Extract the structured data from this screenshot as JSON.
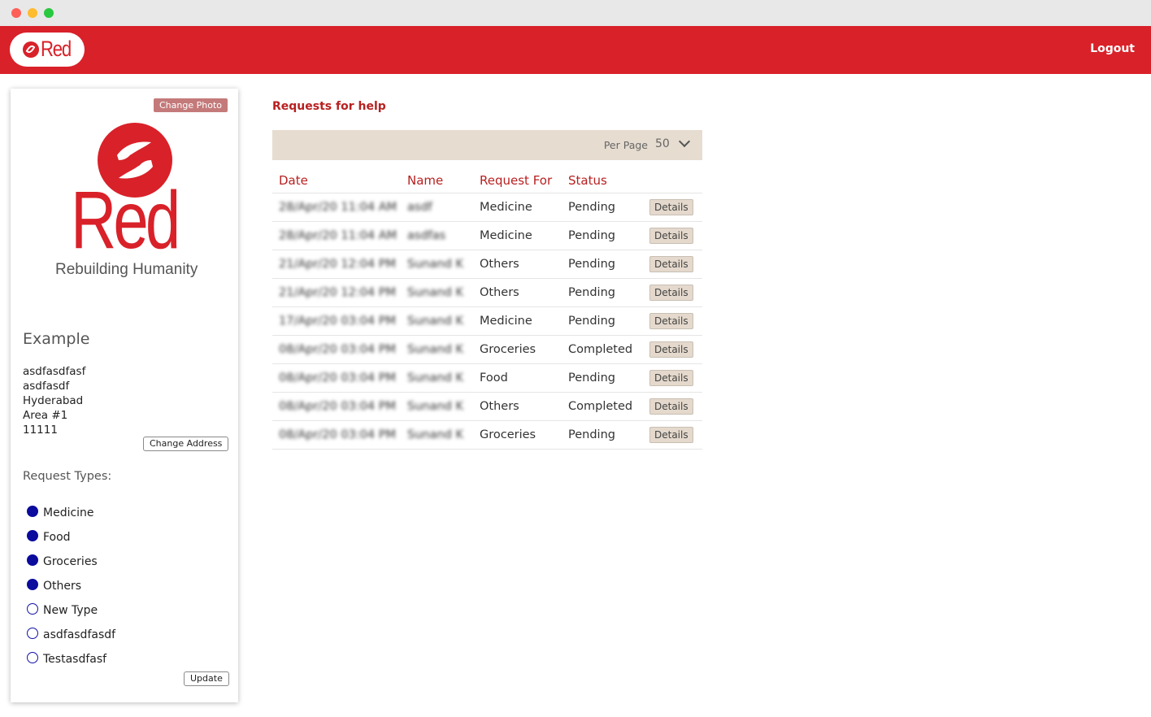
{
  "header": {
    "logo_text": "Red",
    "logout_label": "Logout"
  },
  "profile": {
    "change_photo_label": "Change Photo",
    "brand_name": "Red",
    "brand_tagline": "Rebuilding Humanity",
    "name": "Example",
    "address_lines": [
      "asdfasdfasf",
      "asdfasdf",
      "Hyderabad",
      "Area #1",
      "11111"
    ],
    "change_address_label": "Change Address",
    "request_types_label": "Request Types:",
    "request_types": [
      {
        "label": "Medicine",
        "selected": true
      },
      {
        "label": "Food",
        "selected": true
      },
      {
        "label": "Groceries",
        "selected": true
      },
      {
        "label": "Others",
        "selected": true
      },
      {
        "label": "New Type",
        "selected": false
      },
      {
        "label": "asdfasdfasdf",
        "selected": false
      },
      {
        "label": "Testasdfasf",
        "selected": false
      }
    ],
    "update_label": "Update"
  },
  "main": {
    "title": "Requests for help",
    "per_page_label": "Per Page",
    "per_page_value": "50",
    "columns": [
      "Date",
      "Name",
      "Request For",
      "Status"
    ],
    "details_label": "Details",
    "rows": [
      {
        "date": "28/Apr/20 11:04 AM",
        "name": "asdf",
        "request_for": "Medicine",
        "status": "Pending"
      },
      {
        "date": "28/Apr/20 11:04 AM",
        "name": "asdfas",
        "request_for": "Medicine",
        "status": "Pending"
      },
      {
        "date": "21/Apr/20 12:04 PM",
        "name": "Sunand K",
        "request_for": "Others",
        "status": "Pending"
      },
      {
        "date": "21/Apr/20 12:04 PM",
        "name": "Sunand K",
        "request_for": "Others",
        "status": "Pending"
      },
      {
        "date": "17/Apr/20 03:04 PM",
        "name": "Sunand K",
        "request_for": "Medicine",
        "status": "Pending"
      },
      {
        "date": "08/Apr/20 03:04 PM",
        "name": "Sunand K",
        "request_for": "Groceries",
        "status": "Completed"
      },
      {
        "date": "08/Apr/20 03:04 PM",
        "name": "Sunand K",
        "request_for": "Food",
        "status": "Pending"
      },
      {
        "date": "08/Apr/20 03:04 PM",
        "name": "Sunand K",
        "request_for": "Others",
        "status": "Completed"
      },
      {
        "date": "08/Apr/20 03:04 PM",
        "name": "Sunand K",
        "request_for": "Groceries",
        "status": "Pending"
      }
    ]
  },
  "colors": {
    "brand_red": "#d92129",
    "accent_red_text": "#b82020",
    "radio_blue": "#0b0b9e",
    "filter_bar": "#e6dcd0"
  }
}
